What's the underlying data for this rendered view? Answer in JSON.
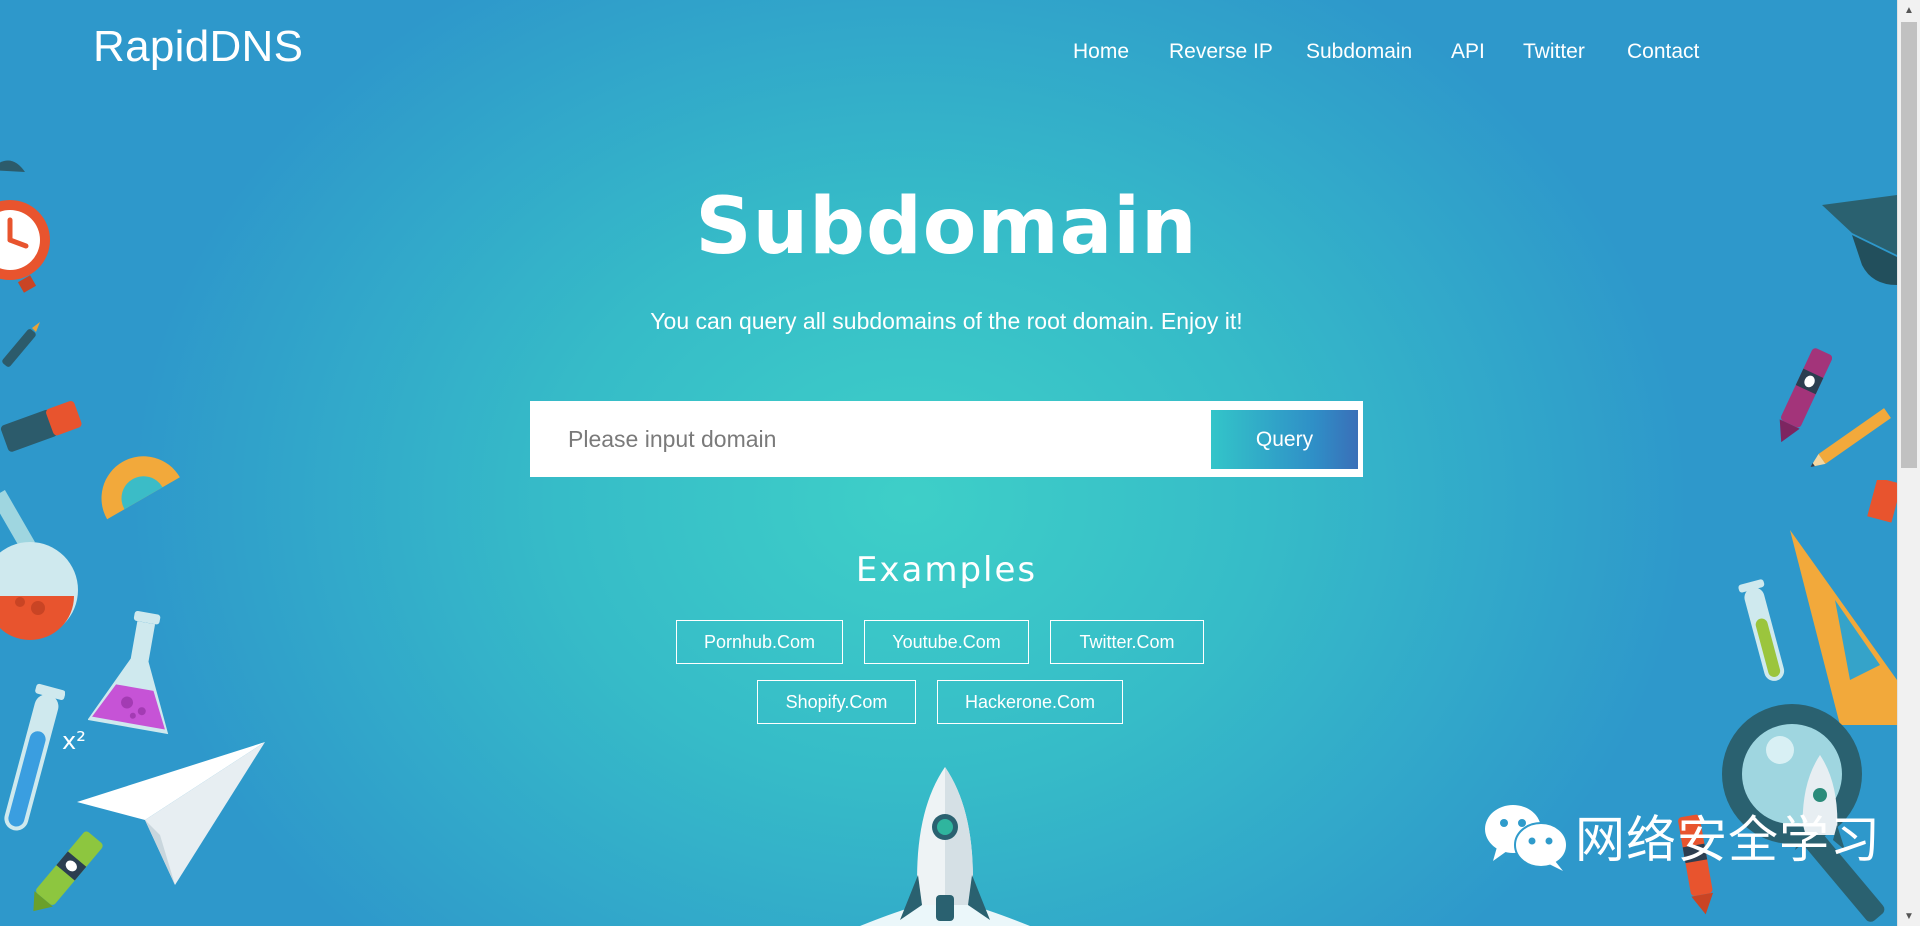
{
  "brand": {
    "name": "RapidDNS"
  },
  "nav": {
    "items": [
      {
        "label": "Home"
      },
      {
        "label": "Reverse IP"
      },
      {
        "label": "Subdomain"
      },
      {
        "label": "API"
      },
      {
        "label": "Twitter"
      },
      {
        "label": "Contact"
      }
    ]
  },
  "hero": {
    "title": "Subdomain",
    "subtitle": "You can query all subdomains of the root domain. Enjoy it!"
  },
  "search": {
    "placeholder": "Please input domain",
    "value": "",
    "button_label": "Query"
  },
  "examples": {
    "title": "Examples",
    "items": [
      {
        "label": "Pornhub.Com"
      },
      {
        "label": "Youtube.Com"
      },
      {
        "label": "Twitter.Com"
      },
      {
        "label": "Shopify.Com"
      },
      {
        "label": "Hackerone.Com"
      }
    ]
  },
  "decorations": {
    "superscript_label": "x²",
    "icons": [
      "alarm-clock-icon",
      "pen-icon",
      "eraser-icon",
      "protractor-icon",
      "flask-icon",
      "erlenmeyer-flask-icon",
      "test-tube-icon",
      "paper-plane-icon",
      "crayon-icon",
      "graduation-cap-icon",
      "pencil-icon",
      "triangle-ruler-icon",
      "magnifier-icon",
      "rocket-icon"
    ]
  },
  "watermark": {
    "text": "网络安全学习",
    "icon": "wechat-icon"
  },
  "colors": {
    "background_center": "#3ecfc8",
    "background_edge": "#2e98cb",
    "button_gradient_start": "#33c5c9",
    "button_gradient_end": "#3a6fb8",
    "text": "#ffffff"
  }
}
